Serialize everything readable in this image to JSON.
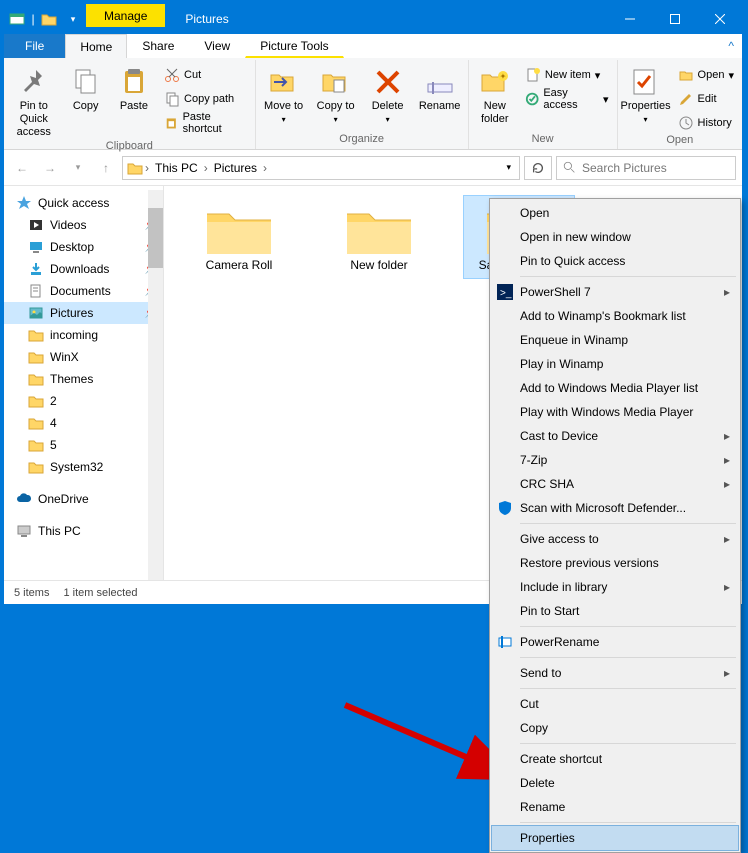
{
  "title": "Pictures",
  "contextual_tab": {
    "group": "Manage",
    "tool": "Picture Tools"
  },
  "tabs": {
    "file": "File",
    "home": "Home",
    "share": "Share",
    "view": "View"
  },
  "ribbon": {
    "clipboard": {
      "pin_quick": "Pin to Quick access",
      "copy": "Copy",
      "paste": "Paste",
      "cut": "Cut",
      "copy_path": "Copy path",
      "paste_shortcut": "Paste shortcut",
      "label": "Clipboard"
    },
    "organize": {
      "move_to": "Move to",
      "copy_to": "Copy to",
      "delete": "Delete",
      "rename": "Rename",
      "label": "Organize"
    },
    "new": {
      "new_folder": "New folder",
      "new_item": "New item",
      "easy_access": "Easy access",
      "label": "New"
    },
    "open": {
      "properties": "Properties",
      "open": "Open",
      "edit": "Edit",
      "history": "History",
      "label": "Open"
    }
  },
  "breadcrumb": [
    "This PC",
    "Pictures"
  ],
  "search_placeholder": "Search Pictures",
  "nav": {
    "quick_access": "Quick access",
    "items": [
      "Videos",
      "Desktop",
      "Downloads",
      "Documents",
      "Pictures",
      "incoming",
      "WinX",
      "Themes",
      "2",
      "4",
      "5",
      "System32"
    ],
    "onedrive": "OneDrive",
    "thispc": "This PC"
  },
  "folders": [
    "Camera Roll",
    "New folder",
    "Saved Pictures"
  ],
  "status": {
    "count": "5 items",
    "sel": "1 item selected"
  },
  "menu": {
    "g1": [
      "Open",
      "Open in new window",
      "Pin to Quick access"
    ],
    "g2": [
      "PowerShell 7",
      "Add to Winamp's Bookmark list",
      "Enqueue in Winamp",
      "Play in Winamp",
      "Add to Windows Media Player list",
      "Play with Windows Media Player",
      "Cast to Device",
      "7-Zip",
      "CRC SHA",
      "Scan with Microsoft Defender..."
    ],
    "g3": [
      "Give access to",
      "Restore previous versions",
      "Include in library",
      "Pin to Start"
    ],
    "g4": [
      "PowerRename"
    ],
    "g5": [
      "Send to"
    ],
    "g6": [
      "Cut",
      "Copy"
    ],
    "g7": [
      "Create shortcut",
      "Delete",
      "Rename"
    ],
    "g8": [
      "Properties"
    ]
  }
}
